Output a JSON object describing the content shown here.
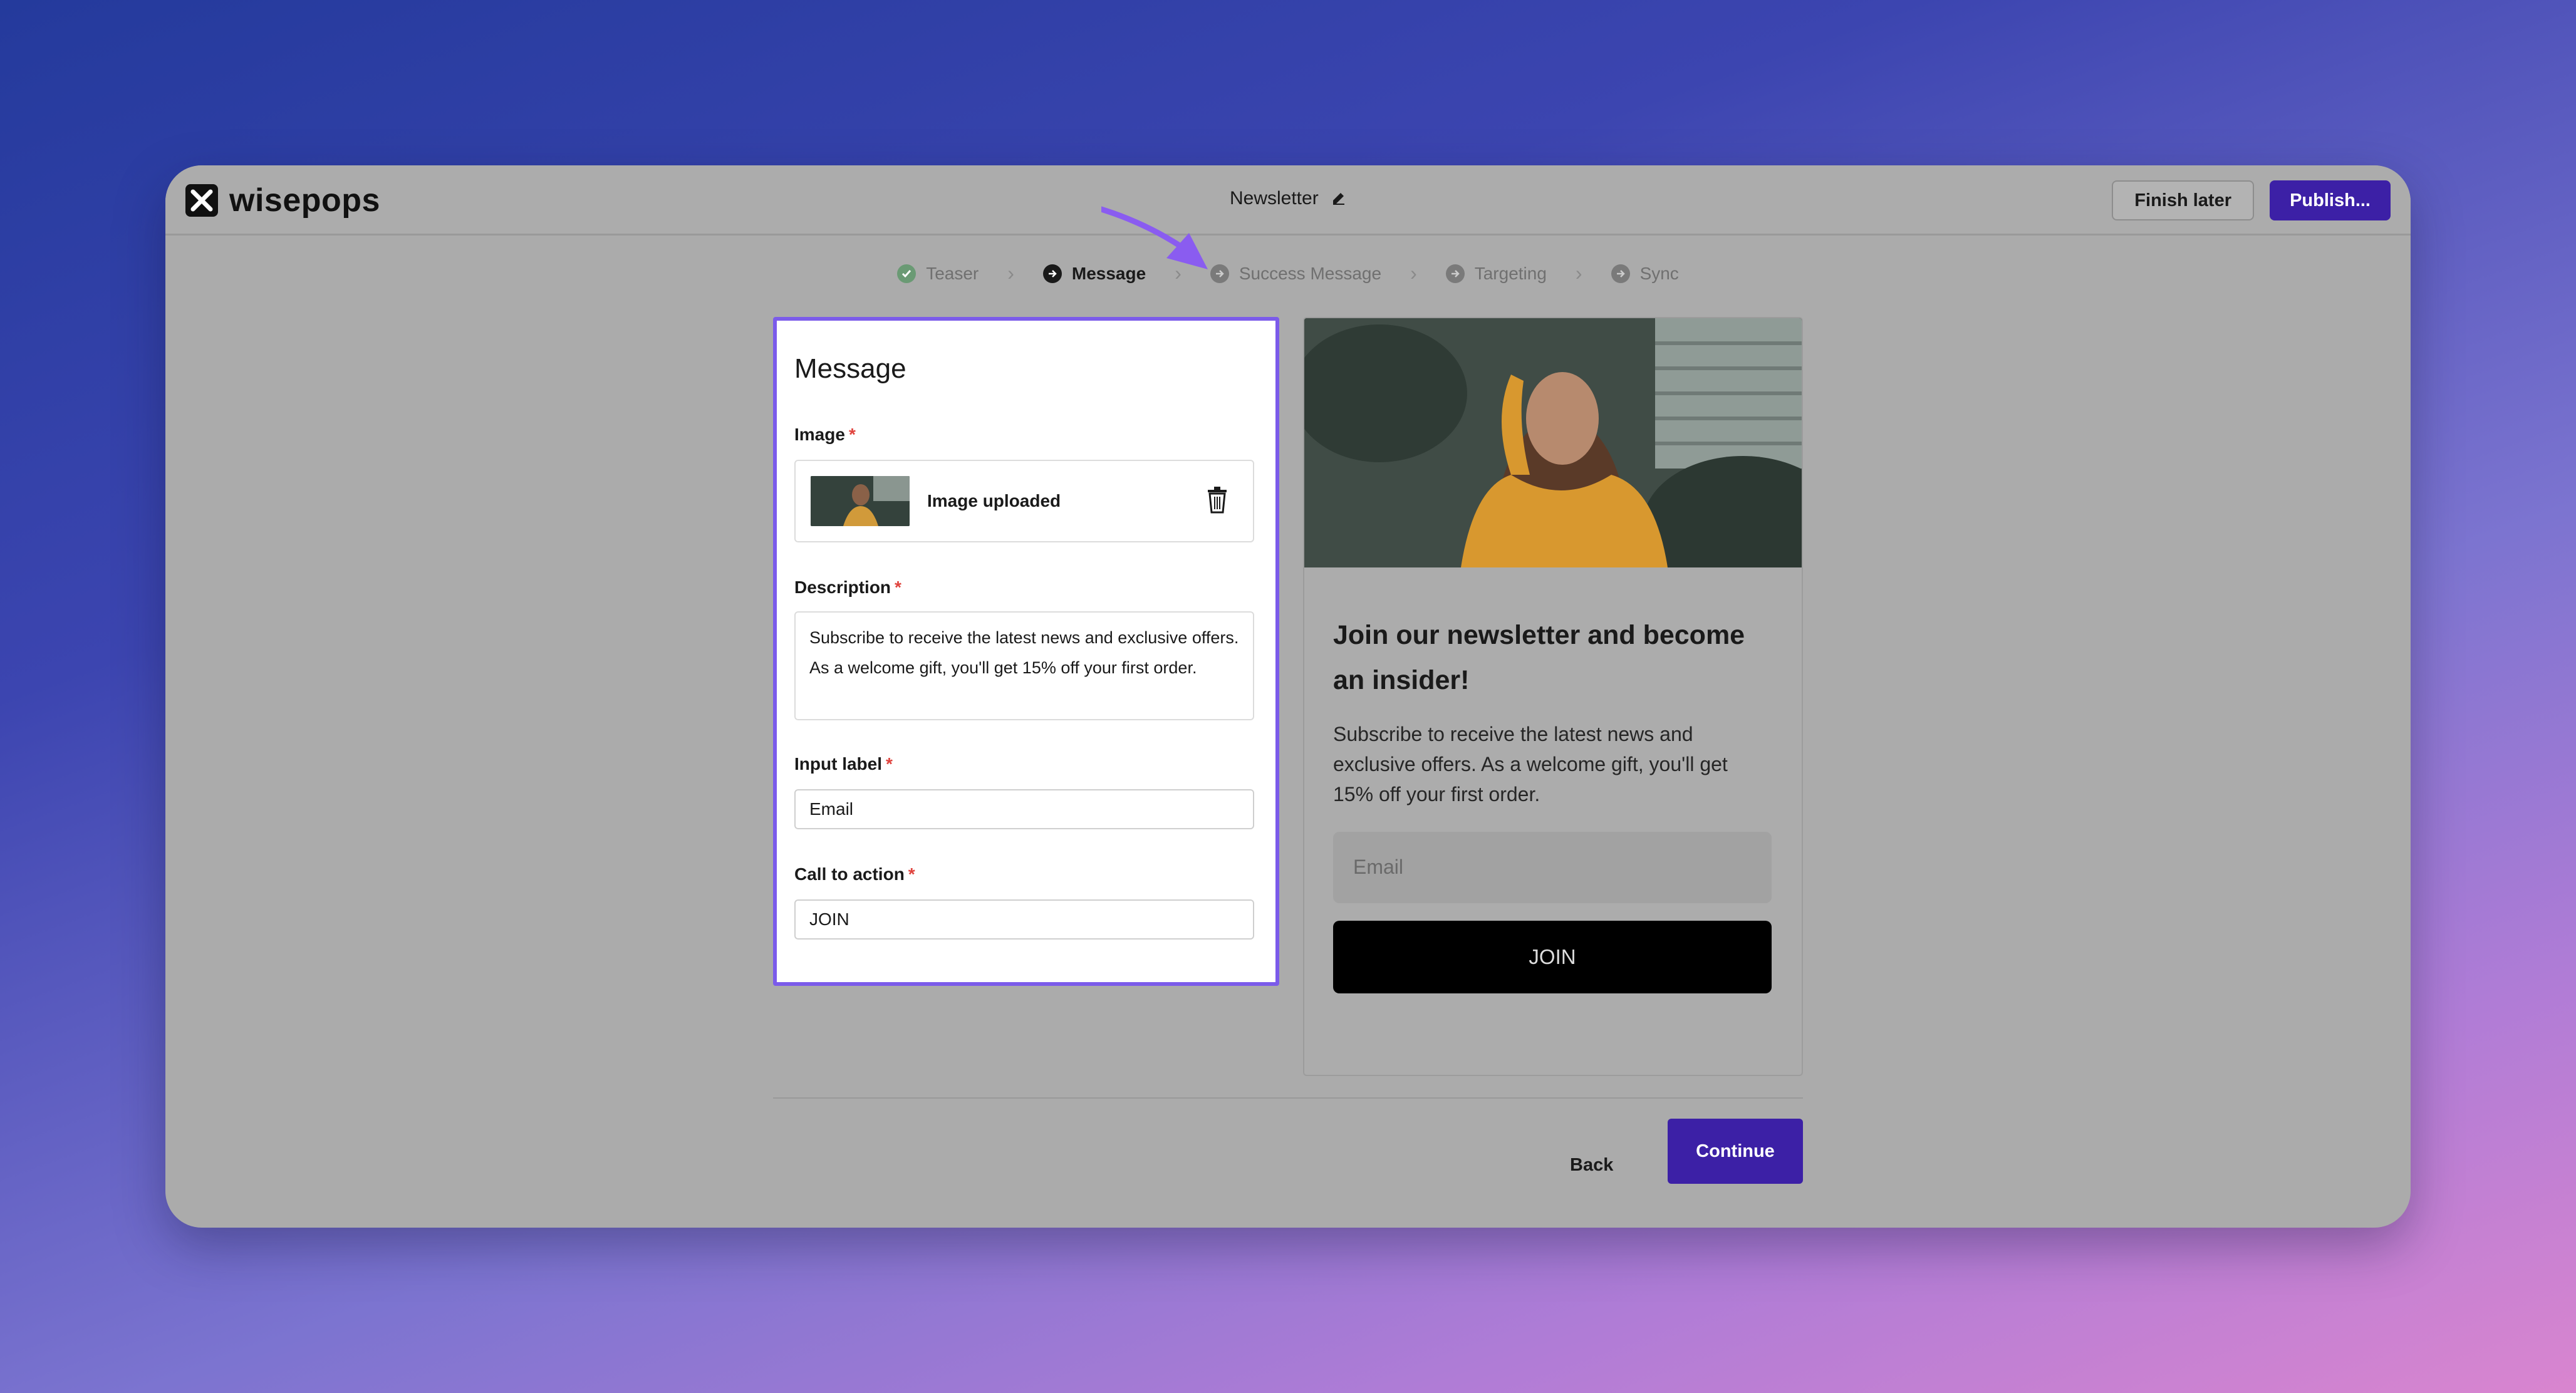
{
  "app": {
    "brand": "wisepops",
    "doc_title": "Newsletter"
  },
  "header": {
    "finish_later": "Finish later",
    "publish": "Publish..."
  },
  "steps": [
    {
      "label": "Teaser",
      "state": "done"
    },
    {
      "label": "Message",
      "state": "active"
    },
    {
      "label": "Success Message",
      "state": "pending"
    },
    {
      "label": "Targeting",
      "state": "pending"
    },
    {
      "label": "Sync",
      "state": "pending"
    }
  ],
  "form": {
    "title": "Message",
    "image_label": "Image",
    "image_status": "Image uploaded",
    "description_label": "Description",
    "description_value": "Subscribe to receive the latest news and exclusive offers. As a welcome gift, you'll get 15% off your first order.",
    "input_label_label": "Input label",
    "input_label_value": "Email",
    "cta_label": "Call to action",
    "cta_value": "JOIN",
    "required_mark": "*"
  },
  "preview": {
    "title": "Join our newsletter and become an insider!",
    "description": "Subscribe to receive the latest news and exclusive offers. As a welcome gift, you'll get 15% off your first order.",
    "input_placeholder": "Email",
    "button": "JOIN"
  },
  "footer": {
    "back": "Back",
    "continue": "Continue"
  },
  "colors": {
    "accent": "#3c20a6",
    "highlight": "#7b5bea",
    "required": "#e0443e"
  }
}
